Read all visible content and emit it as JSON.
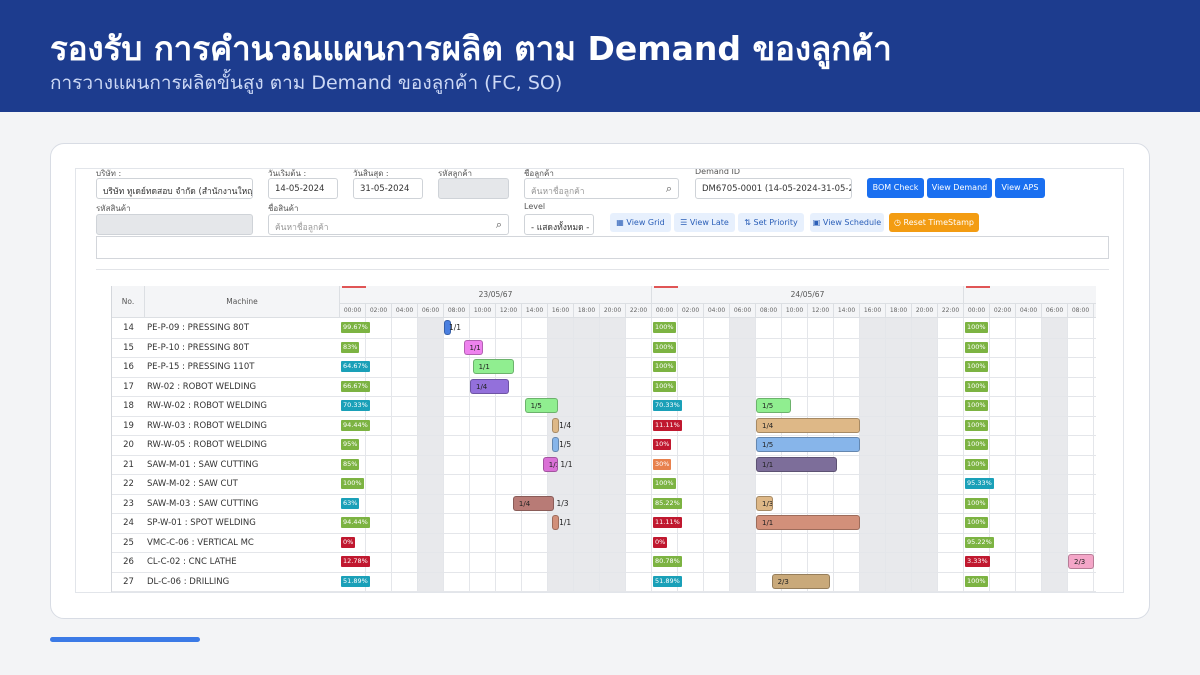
{
  "banner": {
    "title": "รองรับ การคำนวณแผนการผลิต ตาม Demand ของลูกค้า",
    "subtitle": "การวางแผนการผลิตขั้นสูง ตาม Demand ของลูกค้า (FC, SO)"
  },
  "filters": {
    "company_label": "บริษัท :",
    "company_value": "บริษัท ทูเดย์ทดสอบ จำกัด (สำนักงานใหญ่)",
    "start_label": "วันเริ่มต้น :",
    "start_value": "14-05-2024",
    "end_label": "วันสิ้นสุด :",
    "end_value": "31-05-2024",
    "customer_code_label": "รหัสลูกค้า",
    "customer_name_label": "ชื่อลูกค้า",
    "customer_search_placeholder": "ค้นหาชื่อลูกค้า",
    "demand_label": "Demand ID",
    "demand_value": "DM6705-0001 (14-05-2024-31-05-2024)",
    "product_code_label": "รหัสสินค้า",
    "product_name_label": "ชื่อสินค้า",
    "product_search_placeholder": "ค้นหาชื่อลูกค้า",
    "level_label": "Level",
    "level_value": "- แสดงทั้งหมด -"
  },
  "buttons": {
    "bom_check": "BOM Check",
    "view_demand": "View Demand",
    "view_aps": "View APS",
    "view_grid": "View Grid",
    "view_late": "View Late",
    "set_priority": "Set Priority",
    "view_schedule": "View Schedule",
    "reset_timestamp": "Reset TimeStamp"
  },
  "icons": {
    "search": "search-icon",
    "grid": "grid-icon",
    "list": "list-icon",
    "priority": "priority-icon",
    "calendar": "calendar-icon",
    "clock": "clock-icon"
  },
  "gantt": {
    "header_no": "No.",
    "header_machine": "Machine",
    "days": [
      {
        "label": "23/05/67",
        "shade": [
          3,
          8,
          9,
          10
        ]
      },
      {
        "label": "24/05/67",
        "shade": [
          3,
          8,
          9,
          10
        ]
      },
      {
        "label": "",
        "shade": [
          3
        ]
      }
    ],
    "hours": [
      "00:00",
      "02:00",
      "04:00",
      "06:00",
      "08:00",
      "10:00",
      "12:00",
      "14:00",
      "16:00",
      "18:00",
      "20:00",
      "22:00"
    ],
    "rows": [
      {
        "no": "14",
        "machine": "PE-P-09 : PRESSING 80T",
        "pcts": [
          {
            "text": "99.67%",
            "color": "#7cb342",
            "day": 0
          },
          {
            "text": "100%",
            "color": "#7cb342",
            "day": 1
          },
          {
            "text": "100%",
            "color": "#7cb342",
            "day": 2
          }
        ],
        "bars": [
          {
            "day": 0,
            "start": 8,
            "dur": 0.1,
            "color": "#4a7fe0",
            "label": "",
            "after": "1/1"
          }
        ]
      },
      {
        "no": "15",
        "machine": "PE-P-10 : PRESSING 80T",
        "pcts": [
          {
            "text": "83%",
            "color": "#7cb342",
            "day": 0
          },
          {
            "text": "100%",
            "color": "#7cb342",
            "day": 1
          },
          {
            "text": "100%",
            "color": "#7cb342",
            "day": 2
          }
        ],
        "bars": [
          {
            "day": 0,
            "start": 9.5,
            "dur": 1.5,
            "color": "#ee82ee",
            "label": "1/1",
            "after": ""
          }
        ]
      },
      {
        "no": "16",
        "machine": "PE-P-15 : PRESSING 110T",
        "pcts": [
          {
            "text": "64.67%",
            "color": "#1aa0b8",
            "day": 0
          },
          {
            "text": "100%",
            "color": "#7cb342",
            "day": 1
          },
          {
            "text": "100%",
            "color": "#7cb342",
            "day": 2
          }
        ],
        "bars": [
          {
            "day": 0,
            "start": 10.2,
            "dur": 3.2,
            "color": "#90ee90",
            "label": "1/1",
            "after": ""
          }
        ]
      },
      {
        "no": "17",
        "machine": "RW-02 : ROBOT WELDING",
        "pcts": [
          {
            "text": "66.67%",
            "color": "#7cb342",
            "day": 0
          },
          {
            "text": "100%",
            "color": "#7cb342",
            "day": 1
          },
          {
            "text": "100%",
            "color": "#7cb342",
            "day": 2
          }
        ],
        "bars": [
          {
            "day": 0,
            "start": 10,
            "dur": 3,
            "color": "#9370db",
            "label": "1/4",
            "after": ""
          }
        ]
      },
      {
        "no": "18",
        "machine": "RW-W-02 : ROBOT WELDING",
        "pcts": [
          {
            "text": "70.33%",
            "color": "#1aa0b8",
            "day": 0
          },
          {
            "text": "70.33%",
            "color": "#1aa0b8",
            "day": 1
          },
          {
            "text": "100%",
            "color": "#7cb342",
            "day": 2
          }
        ],
        "bars": [
          {
            "day": 0,
            "start": 14.2,
            "dur": 2.6,
            "color": "#90ee90",
            "label": "1/5",
            "after": ""
          },
          {
            "day": 1,
            "start": 8,
            "dur": 2.7,
            "color": "#90ee90",
            "label": "1/5",
            "after": ""
          }
        ]
      },
      {
        "no": "19",
        "machine": "RW-W-03 : ROBOT WELDING",
        "pcts": [
          {
            "text": "94.44%",
            "color": "#7cb342",
            "day": 0
          },
          {
            "text": "11.11%",
            "color": "#c0182f",
            "day": 1
          },
          {
            "text": "100%",
            "color": "#7cb342",
            "day": 2
          }
        ],
        "bars": [
          {
            "day": 0,
            "start": 16.3,
            "dur": 0.4,
            "color": "#deb887",
            "label": "",
            "after": "1/4"
          },
          {
            "day": 1,
            "start": 8,
            "dur": 8,
            "color": "#deb887",
            "label": "1/4",
            "after": ""
          }
        ]
      },
      {
        "no": "20",
        "machine": "RW-W-05 : ROBOT WELDING",
        "pcts": [
          {
            "text": "95%",
            "color": "#7cb342",
            "day": 0
          },
          {
            "text": "10%",
            "color": "#c0182f",
            "day": 1
          },
          {
            "text": "100%",
            "color": "#7cb342",
            "day": 2
          }
        ],
        "bars": [
          {
            "day": 0,
            "start": 16.3,
            "dur": 0.4,
            "color": "#87b5ea",
            "label": "",
            "after": "1/5"
          },
          {
            "day": 1,
            "start": 8,
            "dur": 8,
            "color": "#87b5ea",
            "label": "1/5",
            "after": ""
          }
        ]
      },
      {
        "no": "21",
        "machine": "SAW-M-01 : SAW CUTTING",
        "pcts": [
          {
            "text": "85%",
            "color": "#7cb342",
            "day": 0
          },
          {
            "text": "30%",
            "color": "#e8814d",
            "day": 1
          },
          {
            "text": "100%",
            "color": "#7cb342",
            "day": 2
          }
        ],
        "bars": [
          {
            "day": 0,
            "start": 15.6,
            "dur": 1.2,
            "color": "#da70d6",
            "label": "1/3",
            "after": "1/1"
          },
          {
            "day": 1,
            "start": 8,
            "dur": 6.2,
            "color": "#7d6e9a",
            "label": "1/1",
            "after": ""
          }
        ]
      },
      {
        "no": "22",
        "machine": "SAW-M-02 : SAW CUT",
        "pcts": [
          {
            "text": "100%",
            "color": "#7cb342",
            "day": 0
          },
          {
            "text": "100%",
            "color": "#7cb342",
            "day": 1
          },
          {
            "text": "95.33%",
            "color": "#1aa0b8",
            "day": 2
          }
        ],
        "bars": []
      },
      {
        "no": "23",
        "machine": "SAW-M-03 : SAW CUTTING",
        "pcts": [
          {
            "text": "63%",
            "color": "#1aa0b8",
            "day": 0
          },
          {
            "text": "85.22%",
            "color": "#7cb342",
            "day": 1
          },
          {
            "text": "100%",
            "color": "#7cb342",
            "day": 2
          }
        ],
        "bars": [
          {
            "day": 0,
            "start": 13.3,
            "dur": 3.2,
            "color": "#b87b76",
            "label": "1/4",
            "after": "1/3"
          },
          {
            "day": 1,
            "start": 8,
            "dur": 1.3,
            "color": "#deb887",
            "label": "1/3",
            "after": ""
          }
        ]
      },
      {
        "no": "24",
        "machine": "SP-W-01 : SPOT WELDING",
        "pcts": [
          {
            "text": "94.44%",
            "color": "#7cb342",
            "day": 0
          },
          {
            "text": "11.11%",
            "color": "#c0182f",
            "day": 1
          },
          {
            "text": "100%",
            "color": "#7cb342",
            "day": 2
          }
        ],
        "bars": [
          {
            "day": 0,
            "start": 16.3,
            "dur": 0.4,
            "color": "#d2907a",
            "label": "",
            "after": "1/1"
          },
          {
            "day": 1,
            "start": 8,
            "dur": 8,
            "color": "#d2907a",
            "label": "1/1",
            "after": ""
          }
        ]
      },
      {
        "no": "25",
        "machine": "VMC-C-06 : VERTICAL MC",
        "pcts": [
          {
            "text": "0%",
            "color": "#c0182f",
            "day": 0
          },
          {
            "text": "0%",
            "color": "#c0182f",
            "day": 1
          },
          {
            "text": "95.22%",
            "color": "#7cb342",
            "day": 2
          }
        ],
        "bars": []
      },
      {
        "no": "26",
        "machine": "CL-C-02 : CNC LATHE",
        "pcts": [
          {
            "text": "12.78%",
            "color": "#c0182f",
            "day": 0
          },
          {
            "text": "80.78%",
            "color": "#7cb342",
            "day": 1
          },
          {
            "text": "3.33%",
            "color": "#c0182f",
            "day": 2
          }
        ],
        "bars": [
          {
            "day": 2,
            "start": 8,
            "dur": 2,
            "color": "#f4a6c8",
            "label": "2/3",
            "after": ""
          }
        ]
      },
      {
        "no": "27",
        "machine": "DL-C-06 : DRILLING",
        "pcts": [
          {
            "text": "51.89%",
            "color": "#1aa0b8",
            "day": 0
          },
          {
            "text": "51.89%",
            "color": "#1aa0b8",
            "day": 1
          },
          {
            "text": "100%",
            "color": "#7cb342",
            "day": 2
          }
        ],
        "bars": [
          {
            "day": 1,
            "start": 9.2,
            "dur": 4.5,
            "color": "#c9a97a",
            "label": "2/3",
            "after": ""
          }
        ]
      }
    ]
  }
}
